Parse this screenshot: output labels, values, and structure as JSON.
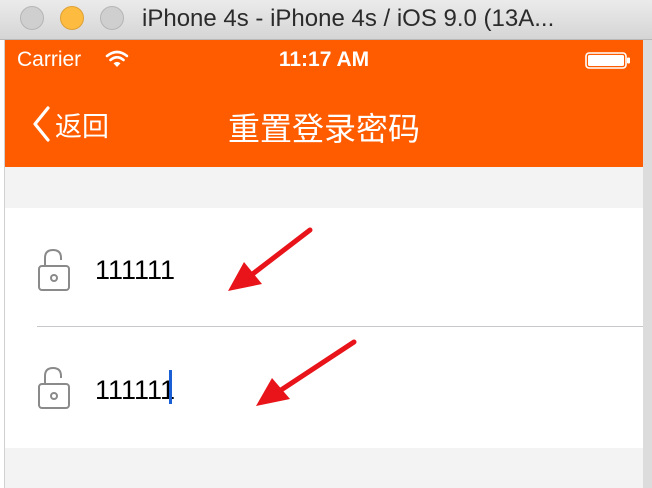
{
  "window": {
    "title": "iPhone 4s - iPhone 4s / iOS 9.0 (13A..."
  },
  "status_bar": {
    "carrier": "Carrier",
    "time": "11:17 AM"
  },
  "nav": {
    "back_label": "返回",
    "title": "重置登录密码"
  },
  "form": {
    "fields": [
      {
        "value": "111111"
      },
      {
        "value": "111111"
      }
    ]
  },
  "colors": {
    "nav_background": "#ff5c00",
    "annotation_arrow": "#e8141a",
    "text_caret": "#1a5fd6"
  }
}
